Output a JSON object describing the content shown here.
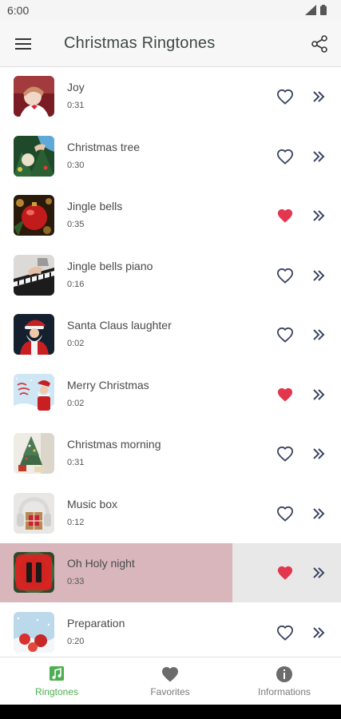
{
  "status": {
    "time": "6:00"
  },
  "app_bar": {
    "title": "Christmas Ringtones"
  },
  "colors": {
    "accent": "#4caf50",
    "heart_filled": "#e2374f",
    "icon": "#3a4560",
    "playing_bg": "#d8b6bb"
  },
  "ringtones": [
    {
      "title": "Joy",
      "duration": "0:31",
      "favorite": false,
      "thumb": "girl-with-bow"
    },
    {
      "title": "Christmas tree",
      "duration": "0:30",
      "favorite": false,
      "thumb": "ornament-hand"
    },
    {
      "title": "Jingle bells",
      "duration": "0:35",
      "favorite": true,
      "thumb": "red-bauble"
    },
    {
      "title": "Jingle bells piano",
      "duration": "0:16",
      "favorite": false,
      "thumb": "piano-hands"
    },
    {
      "title": "Santa Claus laughter",
      "duration": "0:02",
      "favorite": false,
      "thumb": "santa"
    },
    {
      "title": "Merry Christmas",
      "duration": "0:02",
      "favorite": true,
      "thumb": "merry-christmas-card"
    },
    {
      "title": "Christmas morning",
      "duration": "0:31",
      "favorite": false,
      "thumb": "christmas-tree-room"
    },
    {
      "title": "Music box",
      "duration": "0:12",
      "favorite": false,
      "thumb": "gift-headphones"
    },
    {
      "title": "Oh Holy night",
      "duration": "0:33",
      "favorite": true,
      "thumb": "pause-wreath",
      "playing": true
    },
    {
      "title": "Preparation",
      "duration": "0:20",
      "favorite": false,
      "thumb": "winter-decor"
    }
  ],
  "bottom_nav": [
    {
      "label": "Ringtones",
      "icon": "music-note-icon",
      "active": true
    },
    {
      "label": "Favorites",
      "icon": "heart-icon",
      "active": false
    },
    {
      "label": "Informations",
      "icon": "info-icon",
      "active": false
    }
  ]
}
